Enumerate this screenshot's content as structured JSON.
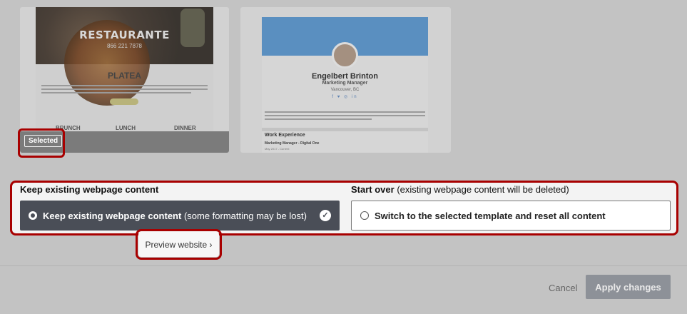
{
  "templates": [
    {
      "title": "RESTAURANTE",
      "phone": "866 221 7878",
      "section": "PLATEA",
      "menu": [
        "BRUNCH",
        "LUNCH",
        "DINNER"
      ],
      "selected_label": "Selected"
    },
    {
      "name": "Engelbert Brinton",
      "role": "Marketing Manager",
      "location": "Vancouver, BC",
      "social": "f ♥ ◎ in",
      "section": "Work Experience",
      "job": "Marketing Manager - Digital One",
      "dates": "May 2017 - Current"
    }
  ],
  "options": {
    "keep_heading": "Keep existing webpage content",
    "start_heading": "Start over",
    "start_heading_note": "(existing webpage content will be deleted)",
    "keep_label": "Keep existing webpage content",
    "keep_note": "(some formatting may be lost)",
    "start_label": "Switch to the selected template and reset all content"
  },
  "preview_label": "Preview website ›",
  "footer": {
    "cancel": "Cancel",
    "apply": "Apply changes"
  },
  "colors": {
    "highlight_ring": "#a80000",
    "selected_option_bg": "#4a4e57",
    "apply_bg": "#8d9198"
  }
}
